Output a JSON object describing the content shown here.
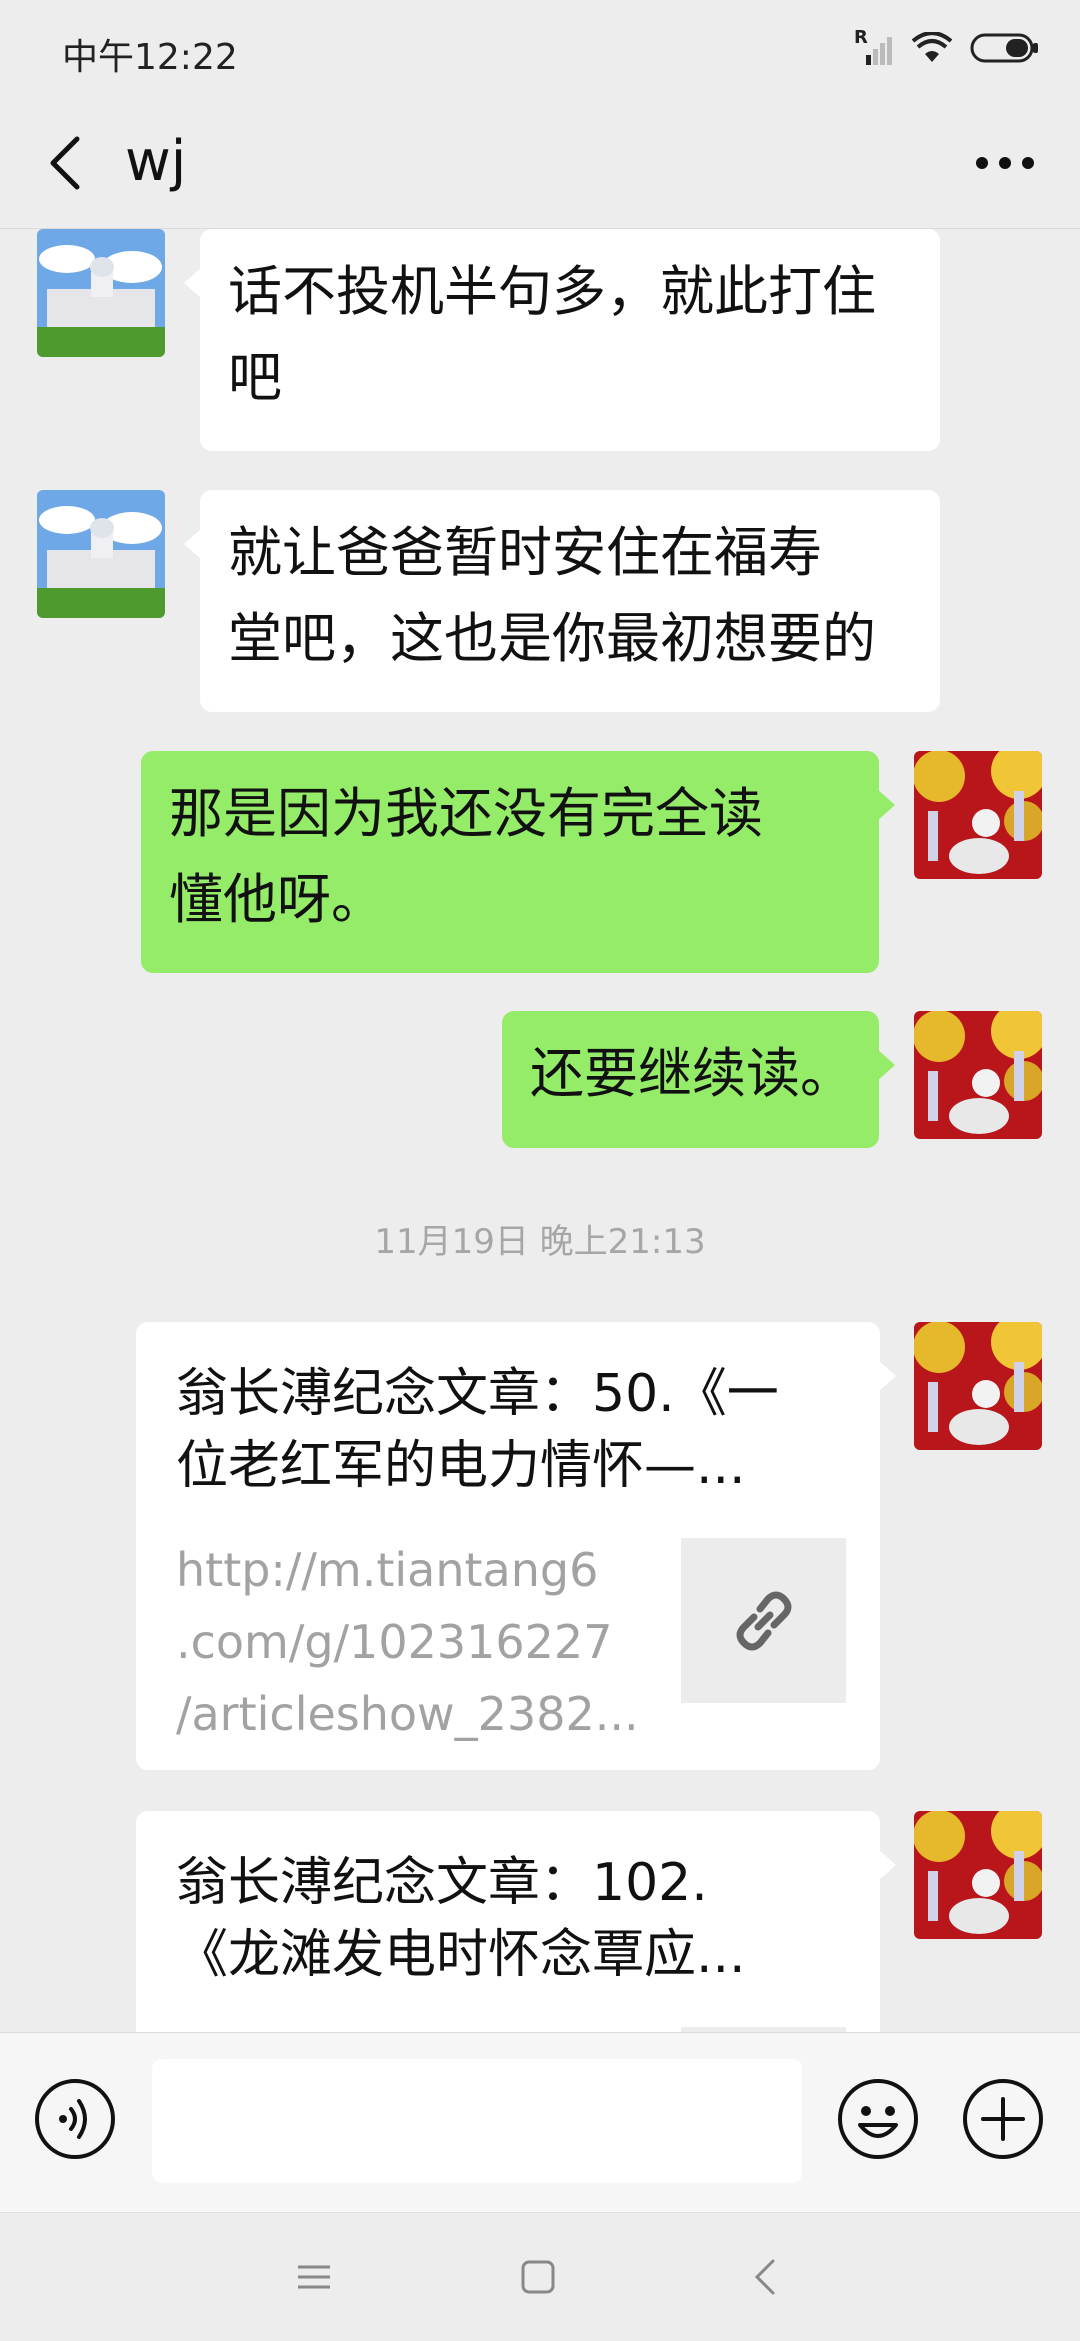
{
  "status_bar": {
    "time": "中午12:22",
    "signal_label": "R"
  },
  "header": {
    "title": "wj"
  },
  "messages": [
    {
      "side": "in",
      "text_lines": [
        "话不投机半句多，就此打住",
        "吧"
      ]
    },
    {
      "side": "in",
      "text_lines": [
        "就让爸爸暂时安住在福寿",
        "堂吧，这也是你最初想要的"
      ]
    },
    {
      "side": "out",
      "text_lines": [
        "那是因为我还没有完全读",
        "懂他呀。"
      ]
    },
    {
      "side": "out",
      "text_lines": [
        "还要继续读。"
      ]
    }
  ],
  "timestamp": "11月19日 晚上21:13",
  "links": [
    {
      "title_lines": [
        "翁长溥纪念文章：50.《一",
        "位老红军的电力情怀—..."
      ],
      "url_lines": [
        "http://m.tiantang6",
        ".com/g/102316227",
        "/articleshow_2382..."
      ]
    },
    {
      "title_lines": [
        "翁长溥纪念文章：102.",
        "《龙滩发电时怀念覃应..."
      ],
      "url_lines": []
    }
  ],
  "input": {
    "placeholder": ""
  },
  "colors": {
    "background": "#ededed",
    "outgoing_bubble": "#95ec69",
    "incoming_bubble": "#ffffff"
  },
  "icons": {
    "back": "chevron-left-icon",
    "more": "more-dots-icon",
    "voice": "voice-icon",
    "emoji": "emoji-icon",
    "plus": "plus-icon",
    "link": "link-icon"
  }
}
